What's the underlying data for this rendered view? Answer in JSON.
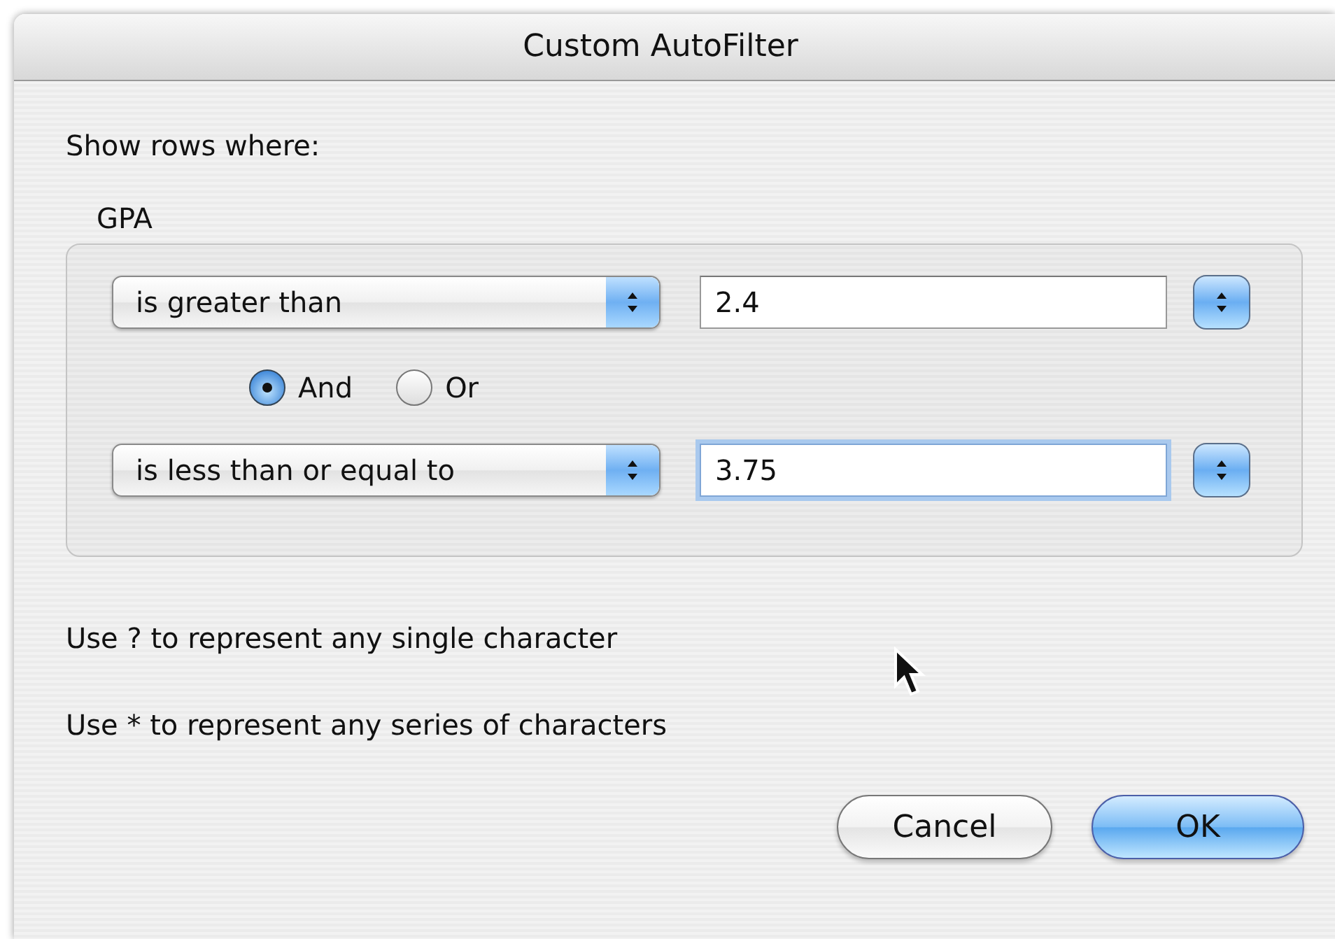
{
  "window": {
    "title": "Custom AutoFilter"
  },
  "intro": "Show rows where:",
  "group": {
    "label": "GPA",
    "criteria": [
      {
        "operator": "is greater than",
        "value": "2.4",
        "focused": false
      },
      {
        "operator": "is less than or equal to",
        "value": "3.75",
        "focused": true
      }
    ],
    "joins": [
      {
        "label": "And",
        "selected": true
      },
      {
        "label": "Or",
        "selected": false
      }
    ]
  },
  "hints": [
    "Use ? to represent any single character",
    "Use * to represent any series of characters"
  ],
  "buttons": [
    {
      "label": "Cancel",
      "default": false
    },
    {
      "label": "OK",
      "default": true
    }
  ]
}
